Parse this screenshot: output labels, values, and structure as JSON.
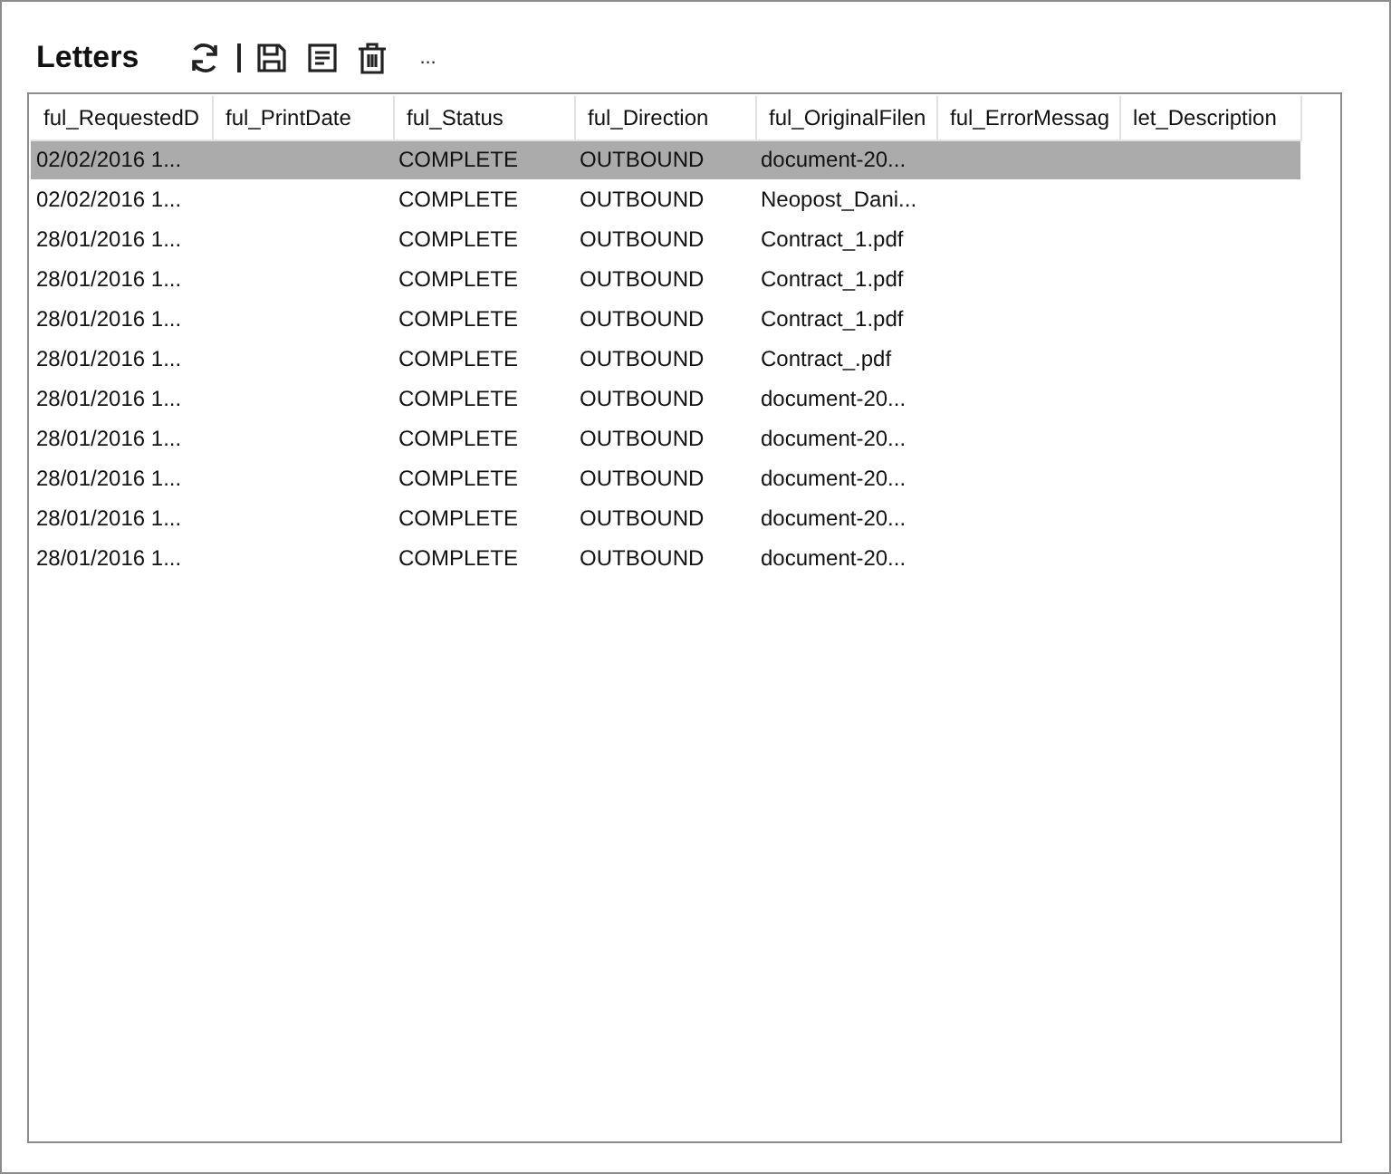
{
  "title": "Letters",
  "toolbar": [
    {
      "kind": "refresh"
    },
    {
      "kind": "separator"
    },
    {
      "kind": "save"
    },
    {
      "kind": "details"
    },
    {
      "kind": "delete"
    },
    {
      "kind": "more",
      "label": "..."
    }
  ],
  "table": {
    "columns": [
      "ful_RequestedD",
      "ful_PrintDate",
      "ful_Status",
      "ful_Direction",
      "ful_OriginalFilen",
      "ful_ErrorMessag",
      "let_Description"
    ],
    "rows": [
      {
        "selected": true,
        "requested_date": "02/02/2016 1...",
        "status": "COMPLETE",
        "direction": "OUTBOUND",
        "original_filename": "document-20..."
      },
      {
        "selected": false,
        "requested_date": "02/02/2016 1...",
        "status": "COMPLETE",
        "direction": "OUTBOUND",
        "original_filename": "Neopost_Dani..."
      },
      {
        "selected": false,
        "requested_date": "28/01/2016 1...",
        "status": "COMPLETE",
        "direction": "OUTBOUND",
        "original_filename": "Contract_1.pdf"
      },
      {
        "selected": false,
        "requested_date": "28/01/2016 1...",
        "status": "COMPLETE",
        "direction": "OUTBOUND",
        "original_filename": "Contract_1.pdf"
      },
      {
        "selected": false,
        "requested_date": "28/01/2016 1...",
        "status": "COMPLETE",
        "direction": "OUTBOUND",
        "original_filename": "Contract_1.pdf"
      },
      {
        "selected": false,
        "requested_date": "28/01/2016 1...",
        "status": "COMPLETE",
        "direction": "OUTBOUND",
        "original_filename": "Contract_.pdf"
      },
      {
        "selected": false,
        "requested_date": "28/01/2016 1...",
        "status": "COMPLETE",
        "direction": "OUTBOUND",
        "original_filename": "document-20..."
      },
      {
        "selected": false,
        "requested_date": "28/01/2016 1...",
        "status": "COMPLETE",
        "direction": "OUTBOUND",
        "original_filename": "document-20..."
      },
      {
        "selected": false,
        "requested_date": "28/01/2016 1...",
        "status": "COMPLETE",
        "direction": "OUTBOUND",
        "original_filename": "document-20..."
      },
      {
        "selected": false,
        "requested_date": "28/01/2016 1...",
        "status": "COMPLETE",
        "direction": "OUTBOUND",
        "original_filename": "document-20..."
      },
      {
        "selected": false,
        "requested_date": "28/01/2016 1...",
        "status": "COMPLETE",
        "direction": "OUTBOUND",
        "original_filename": "document-20..."
      }
    ]
  }
}
